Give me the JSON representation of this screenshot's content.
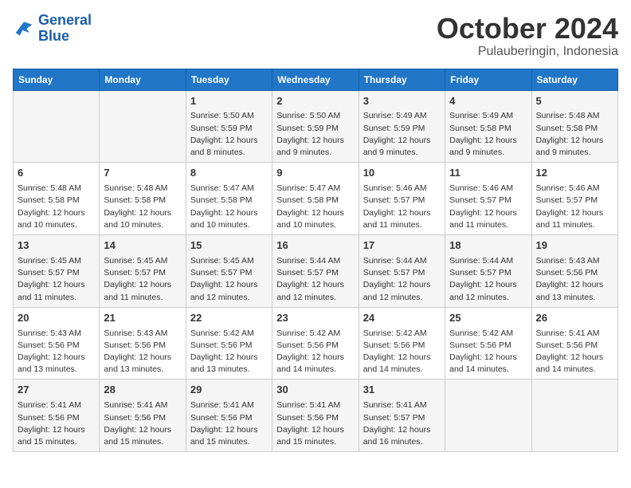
{
  "header": {
    "logo_line1": "General",
    "logo_line2": "Blue",
    "month": "October 2024",
    "location": "Pulauberingin, Indonesia"
  },
  "weekdays": [
    "Sunday",
    "Monday",
    "Tuesday",
    "Wednesday",
    "Thursday",
    "Friday",
    "Saturday"
  ],
  "weeks": [
    [
      {
        "day": "",
        "detail": ""
      },
      {
        "day": "",
        "detail": ""
      },
      {
        "day": "1",
        "detail": "Sunrise: 5:50 AM\nSunset: 5:59 PM\nDaylight: 12 hours\nand 8 minutes."
      },
      {
        "day": "2",
        "detail": "Sunrise: 5:50 AM\nSunset: 5:59 PM\nDaylight: 12 hours\nand 9 minutes."
      },
      {
        "day": "3",
        "detail": "Sunrise: 5:49 AM\nSunset: 5:59 PM\nDaylight: 12 hours\nand 9 minutes."
      },
      {
        "day": "4",
        "detail": "Sunrise: 5:49 AM\nSunset: 5:58 PM\nDaylight: 12 hours\nand 9 minutes."
      },
      {
        "day": "5",
        "detail": "Sunrise: 5:48 AM\nSunset: 5:58 PM\nDaylight: 12 hours\nand 9 minutes."
      }
    ],
    [
      {
        "day": "6",
        "detail": "Sunrise: 5:48 AM\nSunset: 5:58 PM\nDaylight: 12 hours\nand 10 minutes."
      },
      {
        "day": "7",
        "detail": "Sunrise: 5:48 AM\nSunset: 5:58 PM\nDaylight: 12 hours\nand 10 minutes."
      },
      {
        "day": "8",
        "detail": "Sunrise: 5:47 AM\nSunset: 5:58 PM\nDaylight: 12 hours\nand 10 minutes."
      },
      {
        "day": "9",
        "detail": "Sunrise: 5:47 AM\nSunset: 5:58 PM\nDaylight: 12 hours\nand 10 minutes."
      },
      {
        "day": "10",
        "detail": "Sunrise: 5:46 AM\nSunset: 5:57 PM\nDaylight: 12 hours\nand 11 minutes."
      },
      {
        "day": "11",
        "detail": "Sunrise: 5:46 AM\nSunset: 5:57 PM\nDaylight: 12 hours\nand 11 minutes."
      },
      {
        "day": "12",
        "detail": "Sunrise: 5:46 AM\nSunset: 5:57 PM\nDaylight: 12 hours\nand 11 minutes."
      }
    ],
    [
      {
        "day": "13",
        "detail": "Sunrise: 5:45 AM\nSunset: 5:57 PM\nDaylight: 12 hours\nand 11 minutes."
      },
      {
        "day": "14",
        "detail": "Sunrise: 5:45 AM\nSunset: 5:57 PM\nDaylight: 12 hours\nand 11 minutes."
      },
      {
        "day": "15",
        "detail": "Sunrise: 5:45 AM\nSunset: 5:57 PM\nDaylight: 12 hours\nand 12 minutes."
      },
      {
        "day": "16",
        "detail": "Sunrise: 5:44 AM\nSunset: 5:57 PM\nDaylight: 12 hours\nand 12 minutes."
      },
      {
        "day": "17",
        "detail": "Sunrise: 5:44 AM\nSunset: 5:57 PM\nDaylight: 12 hours\nand 12 minutes."
      },
      {
        "day": "18",
        "detail": "Sunrise: 5:44 AM\nSunset: 5:57 PM\nDaylight: 12 hours\nand 12 minutes."
      },
      {
        "day": "19",
        "detail": "Sunrise: 5:43 AM\nSunset: 5:56 PM\nDaylight: 12 hours\nand 13 minutes."
      }
    ],
    [
      {
        "day": "20",
        "detail": "Sunrise: 5:43 AM\nSunset: 5:56 PM\nDaylight: 12 hours\nand 13 minutes."
      },
      {
        "day": "21",
        "detail": "Sunrise: 5:43 AM\nSunset: 5:56 PM\nDaylight: 12 hours\nand 13 minutes."
      },
      {
        "day": "22",
        "detail": "Sunrise: 5:42 AM\nSunset: 5:56 PM\nDaylight: 12 hours\nand 13 minutes."
      },
      {
        "day": "23",
        "detail": "Sunrise: 5:42 AM\nSunset: 5:56 PM\nDaylight: 12 hours\nand 14 minutes."
      },
      {
        "day": "24",
        "detail": "Sunrise: 5:42 AM\nSunset: 5:56 PM\nDaylight: 12 hours\nand 14 minutes."
      },
      {
        "day": "25",
        "detail": "Sunrise: 5:42 AM\nSunset: 5:56 PM\nDaylight: 12 hours\nand 14 minutes."
      },
      {
        "day": "26",
        "detail": "Sunrise: 5:41 AM\nSunset: 5:56 PM\nDaylight: 12 hours\nand 14 minutes."
      }
    ],
    [
      {
        "day": "27",
        "detail": "Sunrise: 5:41 AM\nSunset: 5:56 PM\nDaylight: 12 hours\nand 15 minutes."
      },
      {
        "day": "28",
        "detail": "Sunrise: 5:41 AM\nSunset: 5:56 PM\nDaylight: 12 hours\nand 15 minutes."
      },
      {
        "day": "29",
        "detail": "Sunrise: 5:41 AM\nSunset: 5:56 PM\nDaylight: 12 hours\nand 15 minutes."
      },
      {
        "day": "30",
        "detail": "Sunrise: 5:41 AM\nSunset: 5:56 PM\nDaylight: 12 hours\nand 15 minutes."
      },
      {
        "day": "31",
        "detail": "Sunrise: 5:41 AM\nSunset: 5:57 PM\nDaylight: 12 hours\nand 16 minutes."
      },
      {
        "day": "",
        "detail": ""
      },
      {
        "day": "",
        "detail": ""
      }
    ]
  ]
}
